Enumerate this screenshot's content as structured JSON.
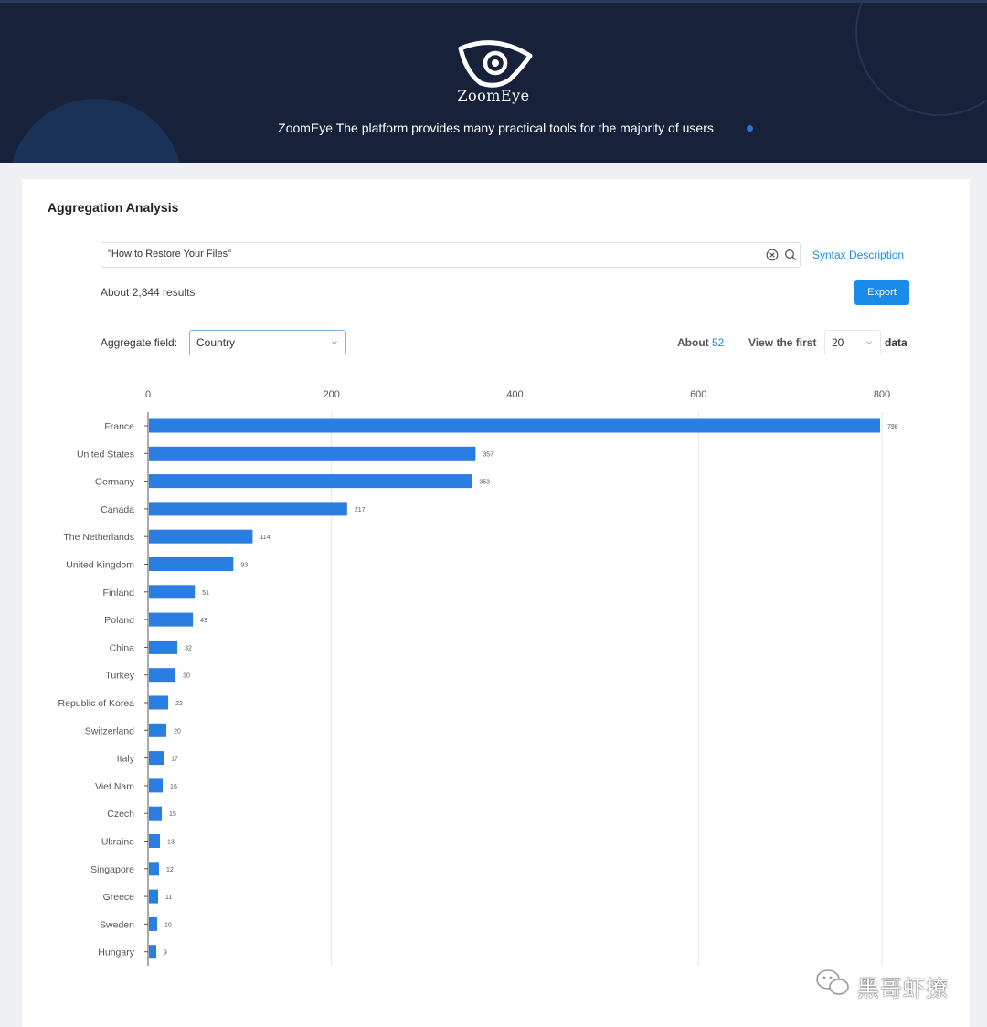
{
  "header": {
    "logo_text": "ZoomEye",
    "tagline": "ZoomEye The platform provides many practical tools for the majority of users"
  },
  "card": {
    "title": "Aggregation Analysis"
  },
  "search": {
    "value": "\"How to Restore Your Files\"",
    "syntax_link": "Syntax Description"
  },
  "results": {
    "text": "About 2,344 results",
    "export_label": "Export"
  },
  "aggregate": {
    "label": "Aggregate field:",
    "selected": "Country",
    "about_prefix": "About",
    "about_count": "52",
    "view_first_label": "View the first",
    "view_first_value": "20",
    "data_word": "data"
  },
  "chart_data": {
    "type": "bar",
    "orientation": "horizontal",
    "categories": [
      "France",
      "United States",
      "Germany",
      "Canada",
      "The Netherlands",
      "United Kingdom",
      "Finland",
      "Poland",
      "China",
      "Turkey",
      "Republic of Korea",
      "Switzerland",
      "Italy",
      "Viet Nam",
      "Czech",
      "Ukraine",
      "Singapore",
      "Greece",
      "Sweden",
      "Hungary"
    ],
    "values": [
      798,
      357,
      353,
      217,
      114,
      93,
      51,
      49,
      32,
      30,
      22,
      20,
      17,
      16,
      15,
      13,
      12,
      11,
      10,
      9
    ],
    "x_ticks": [
      "0",
      "200",
      "400",
      "600",
      "800"
    ],
    "xlim": [
      0,
      800
    ],
    "grid": true,
    "bar_color": "#2a7de1"
  },
  "watermark": {
    "text": "黑哥虾撩"
  },
  "colors": {
    "header_bg": "#17223a",
    "accent": "#1a8be8",
    "bar": "#2a7de1"
  }
}
